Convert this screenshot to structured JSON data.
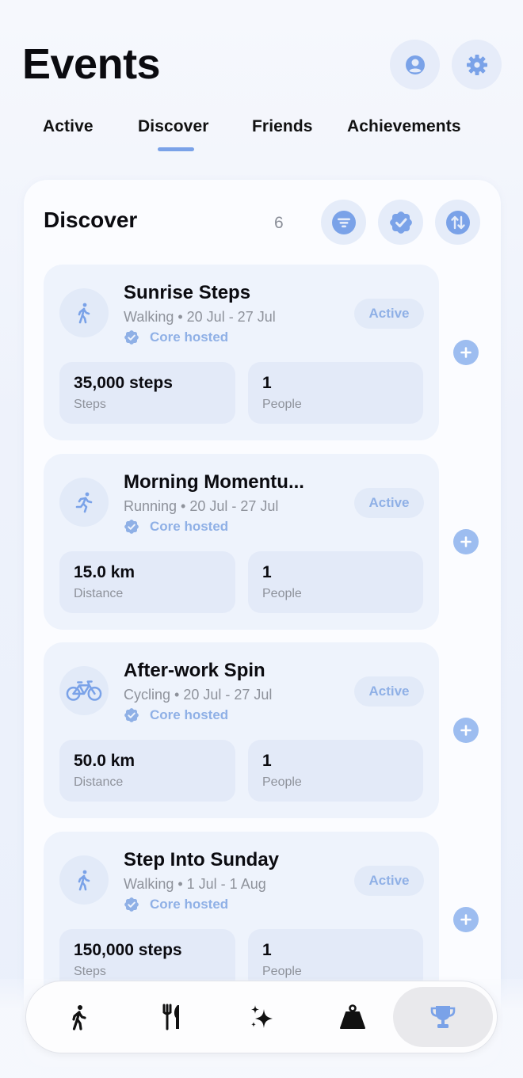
{
  "header": {
    "title": "Events",
    "profile_icon": "person-circle-icon",
    "settings_icon": "gear-icon"
  },
  "tabs": [
    {
      "label": "Active",
      "selected": false
    },
    {
      "label": "Discover",
      "selected": true
    },
    {
      "label": "Friends",
      "selected": false
    },
    {
      "label": "Achievements",
      "selected": false
    }
  ],
  "panel": {
    "title": "Discover",
    "count": "6",
    "actions": [
      "filter-icon",
      "verified-badge-icon",
      "sort-icon"
    ]
  },
  "events": [
    {
      "name": "Sunrise Steps",
      "subtitle": "Walking • 20 Jul - 27 Jul",
      "hosted": "Core hosted",
      "status": "Active",
      "icon": "walking-icon",
      "stat1_value": "35,000 steps",
      "stat1_label": "Steps",
      "stat2_value": "1",
      "stat2_label": "People"
    },
    {
      "name": "Morning Momentu...",
      "subtitle": "Running • 20 Jul - 27 Jul",
      "hosted": "Core hosted",
      "status": "Active",
      "icon": "running-icon",
      "stat1_value": "15.0 km",
      "stat1_label": "Distance",
      "stat2_value": "1",
      "stat2_label": "People"
    },
    {
      "name": "After-work Spin",
      "subtitle": "Cycling • 20 Jul - 27 Jul",
      "hosted": "Core hosted",
      "status": "Active",
      "icon": "bicycle-icon",
      "stat1_value": "50.0 km",
      "stat1_label": "Distance",
      "stat2_value": "1",
      "stat2_label": "People"
    },
    {
      "name": "Step Into Sunday",
      "subtitle": "Walking • 1 Jul - 1 Aug",
      "hosted": "Core hosted",
      "status": "Active",
      "icon": "walking-icon",
      "stat1_value": "150,000 steps",
      "stat1_label": "Steps",
      "stat2_value": "1",
      "stat2_label": "People"
    }
  ],
  "tabbar": {
    "items": [
      "walking-icon",
      "fork-knife-icon",
      "sparkles-icon",
      "weight-icon",
      "trophy-icon"
    ],
    "selected": "trophy-icon"
  },
  "colors": {
    "accent": "#8fb0e6",
    "add_button": "#9dbdf0",
    "card_bg": "#eef3fc"
  }
}
